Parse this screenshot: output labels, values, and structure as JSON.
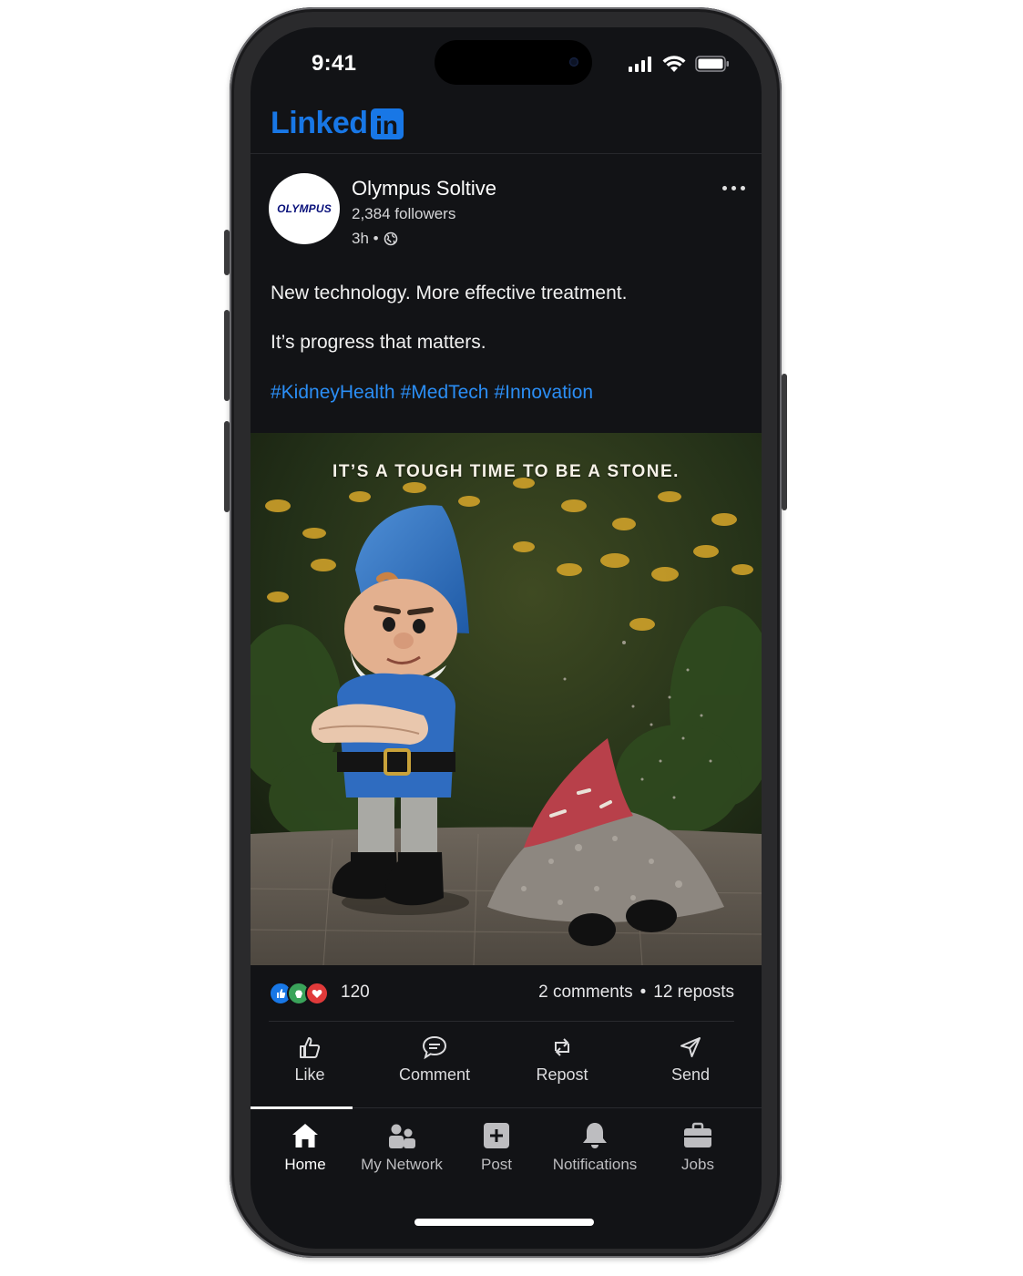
{
  "status_bar": {
    "time": "9:41"
  },
  "header": {
    "logo_text": "Linked",
    "logo_box_text": "in"
  },
  "post": {
    "author": {
      "avatar_text": "OLYMPUS",
      "name": "Olympus Soltive",
      "followers": "2,384 followers",
      "time": "3h •"
    },
    "body_lines": [
      "New technology. More effective treatment.",
      "It’s progress that matters."
    ],
    "hashtags": [
      "#KidneyHealth",
      "#MedTech",
      "#Innovation"
    ],
    "media": {
      "caption": "IT’S A TOUGH TIME TO BE A STONE."
    },
    "social": {
      "reaction_count": "120",
      "comments": "2 comments",
      "separator": "•",
      "reposts": "12 reposts"
    },
    "actions": [
      {
        "label": "Like",
        "icon": "like-icon"
      },
      {
        "label": "Comment",
        "icon": "comment-icon"
      },
      {
        "label": "Repost",
        "icon": "repost-icon"
      },
      {
        "label": "Send",
        "icon": "send-icon"
      }
    ]
  },
  "tab_bar": {
    "active": "Home",
    "tabs": [
      {
        "label": "Home",
        "icon": "home-icon"
      },
      {
        "label": "My Network",
        "icon": "network-icon"
      },
      {
        "label": "Post",
        "icon": "post-icon"
      },
      {
        "label": "Notifications",
        "icon": "bell-icon"
      },
      {
        "label": "Jobs",
        "icon": "briefcase-icon"
      }
    ]
  },
  "colors": {
    "background": "#121316",
    "brand_blue": "#1877e6",
    "hashtag_blue": "#2b8ef5",
    "text": "#ffffff"
  }
}
